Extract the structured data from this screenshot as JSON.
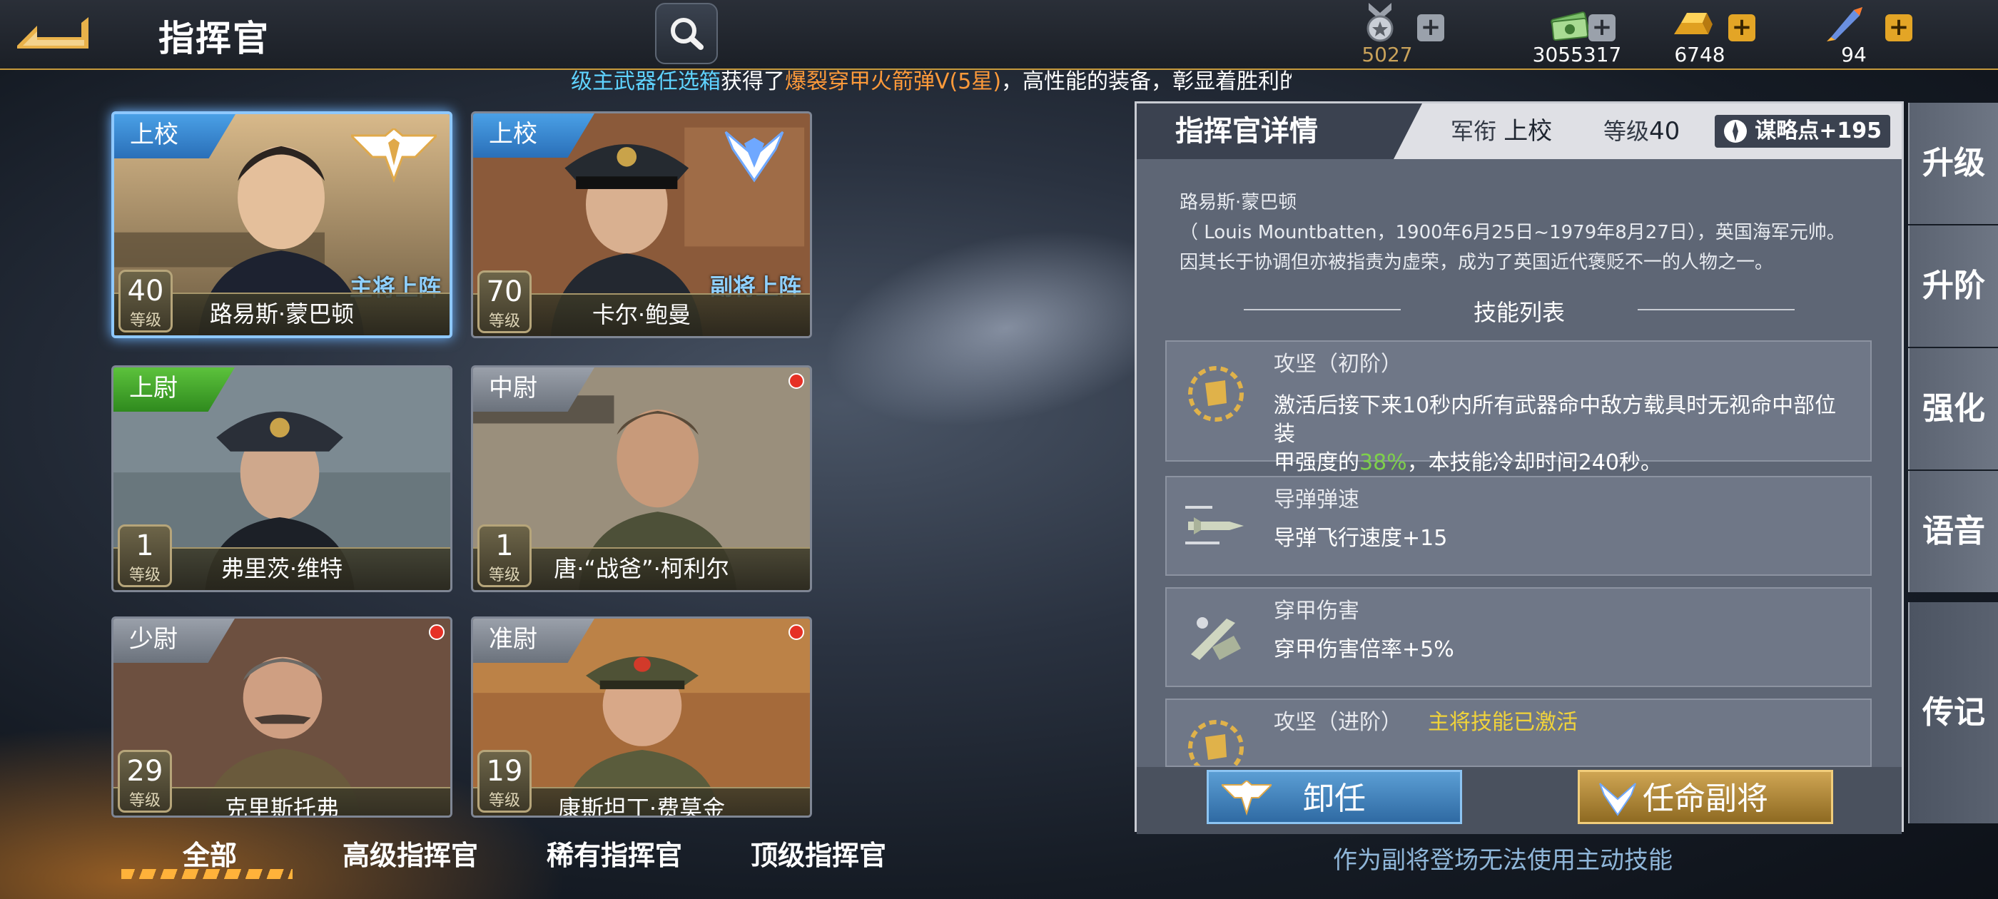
{
  "header": {
    "title": "指挥官",
    "resources": [
      {
        "name": "medal",
        "icon": "medal-icon",
        "value": "5027",
        "plus": "+"
      },
      {
        "name": "cash",
        "icon": "cash-icon",
        "value": "3055317",
        "plus": "+"
      },
      {
        "name": "gold",
        "icon": "gold-bar-icon",
        "value": "6748",
        "plus": "+"
      },
      {
        "name": "rocket",
        "icon": "rocket-icon",
        "value": "94",
        "plus": "+"
      }
    ]
  },
  "ticker": {
    "part1": "级主武器任选箱",
    "part2": "获得了",
    "part3": "爆裂穿甲火箭弹V(5星)",
    "part4": "，高性能的装备，彰显着胜利的"
  },
  "cards": [
    {
      "rank": "上校",
      "name": "路易斯·蒙巴顿",
      "level": "40",
      "level_label": "等级",
      "role": "主将上阵"
    },
    {
      "rank": "上校",
      "name": "卡尔·鲍曼",
      "level": "70",
      "level_label": "等级",
      "role": "副将上阵"
    },
    {
      "rank": "上尉",
      "name": "弗里茨·维特",
      "level": "1",
      "level_label": "等级"
    },
    {
      "rank": "中尉",
      "name": "唐·“战爸”·柯利尔",
      "level": "1",
      "level_label": "等级"
    },
    {
      "rank": "少尉",
      "name": "克里斯托弗",
      "level": "29",
      "level_label": "等级"
    },
    {
      "rank": "准尉",
      "name": "康斯坦丁·费莫金",
      "level": "19",
      "level_label": "等级"
    }
  ],
  "tabs": [
    "全部",
    "高级指挥官",
    "稀有指挥官",
    "顶级指挥官"
  ],
  "detail": {
    "title": "指挥官详情",
    "rank_label": "军衔",
    "rank": "上校",
    "level_label": "等级",
    "level": "40",
    "strategy_points": "谋略点+195",
    "bio_name": "路易斯·蒙巴顿",
    "bio_line1": "（ Louis Mountbatten，1900年6月25日~1979年8月27日），英国海军元帅。",
    "bio_line2": "因其长于协调但亦被指责为虚荣，成为了英国近代褒贬不一的人物之一。",
    "skills_title": "技能列表",
    "skills": [
      {
        "name": "攻坚（初阶）",
        "desc_a": "激活后接下来10秒内所有武器命中敌方载具时无视命中部位装",
        "desc_b": "甲强度的",
        "desc_pct": "38%",
        "desc_c": "，本技能冷却时间240秒。"
      },
      {
        "name": "导弹弹速",
        "desc": "导弹飞行速度+15"
      },
      {
        "name": "穿甲伤害",
        "desc": "穿甲伤害倍率+5%"
      },
      {
        "name": "攻坚（进阶）",
        "active": "主将技能已激活"
      }
    ],
    "btn_dismiss": "卸任",
    "btn_appoint": "任命副将",
    "hint": "作为副将登场无法使用主动技能"
  },
  "side_tabs": [
    "升级",
    "升阶",
    "强化",
    "语音",
    "传记"
  ],
  "colors": {
    "accent_gold": "#c79a3c",
    "highlight_green": "#7ed04b",
    "active_yellow": "#f1d33a",
    "alert_red": "#e63025"
  }
}
